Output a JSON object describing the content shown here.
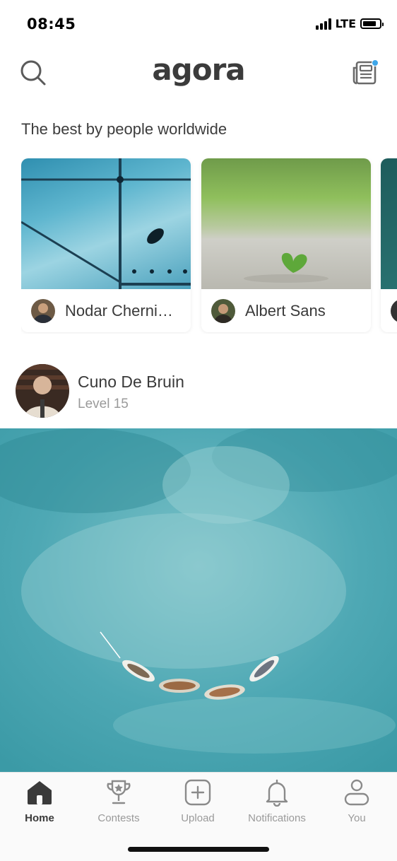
{
  "status": {
    "time": "08:45",
    "network": "LTE",
    "battery_level": 0.8
  },
  "header": {
    "brand": "agora",
    "has_notification_dot": true
  },
  "icons": {
    "search": "search-icon",
    "news": "newspaper-icon",
    "home": "home-icon",
    "contests": "trophy-icon",
    "upload": "plus-square-icon",
    "notifications": "bell-icon",
    "you": "user-icon"
  },
  "section": {
    "title": "The best by people worldwide"
  },
  "cards": [
    {
      "author": "Nodar Cherni…"
    },
    {
      "author": "Albert Sans"
    }
  ],
  "post": {
    "author": "Cuno De Bruin",
    "level": "Level 15"
  },
  "tabs": [
    {
      "label": "Home",
      "active": true
    },
    {
      "label": "Contests",
      "active": false
    },
    {
      "label": "Upload",
      "active": false
    },
    {
      "label": "Notifications",
      "active": false
    },
    {
      "label": "You",
      "active": false
    }
  ],
  "colors": {
    "accent_dot": "#3fa6e8",
    "text": "#3a3a3a",
    "muted": "#9a9a9a",
    "water": "#4ea8b4"
  }
}
